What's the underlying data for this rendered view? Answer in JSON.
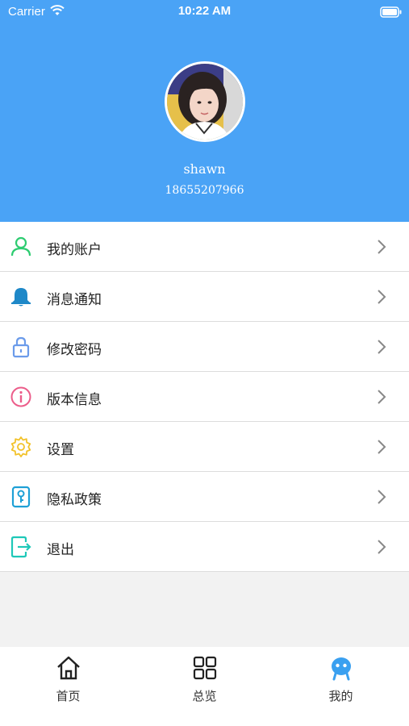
{
  "status_bar": {
    "carrier": "Carrier",
    "time": "10:22 AM"
  },
  "profile": {
    "username": "shawn",
    "phone": "18655207966"
  },
  "menu": [
    {
      "label": "我的账户",
      "icon": "user-icon",
      "color": "#2ecc71"
    },
    {
      "label": "消息通知",
      "icon": "bell-icon",
      "color": "#1e88c8"
    },
    {
      "label": "修改密码",
      "icon": "lock-icon",
      "color": "#6b9bea"
    },
    {
      "label": "版本信息",
      "icon": "info-icon",
      "color": "#ec5d8a"
    },
    {
      "label": "设置",
      "icon": "gear-icon",
      "color": "#f2c22a"
    },
    {
      "label": "隐私政策",
      "icon": "privacy-icon",
      "color": "#1ea0d6"
    },
    {
      "label": "退出",
      "icon": "exit-icon",
      "color": "#1ec8b8"
    }
  ],
  "tabbar": {
    "items": [
      {
        "label": "首页",
        "icon": "home-icon"
      },
      {
        "label": "总览",
        "icon": "grid-icon"
      },
      {
        "label": "我的",
        "icon": "robot-icon",
        "active": true
      }
    ],
    "active_color": "#3aa0f0"
  },
  "colors": {
    "header_bg": "#4aa3f6",
    "page_bg": "#f2f2f2"
  }
}
